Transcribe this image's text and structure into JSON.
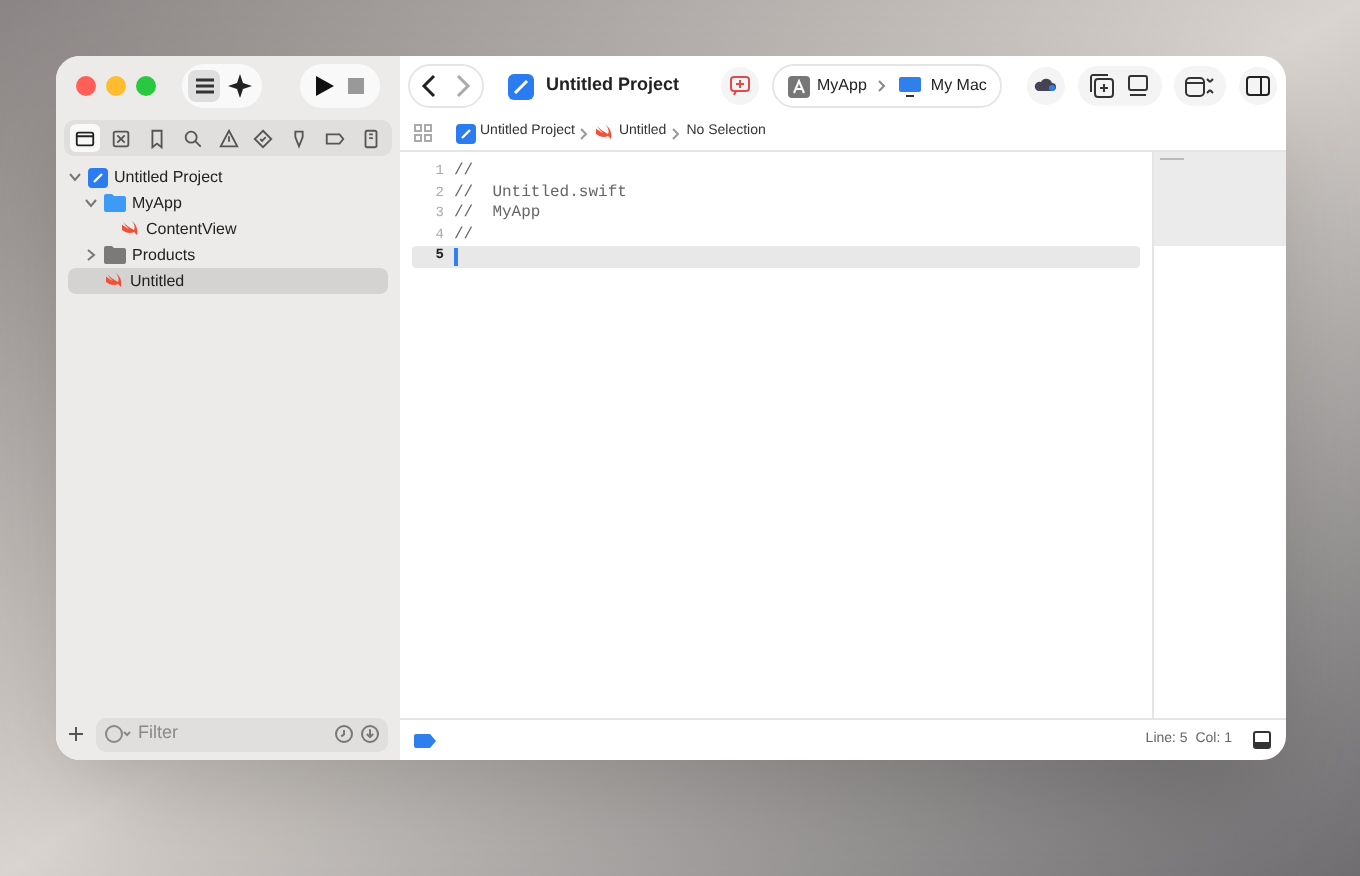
{
  "toolbar": {
    "project_title": "Untitled Project",
    "scheme": "MyApp",
    "destination": "My Mac"
  },
  "navigator_tabs": [
    {
      "selected": true
    },
    {
      "selected": false
    },
    {
      "selected": false
    },
    {
      "selected": false
    },
    {
      "selected": false
    },
    {
      "selected": false
    },
    {
      "selected": false
    },
    {
      "selected": false
    },
    {
      "selected": false
    }
  ],
  "tree": [
    {
      "label": "Untitled Project",
      "kind": "project",
      "expanded": true,
      "selected": false,
      "children": [
        {
          "label": "MyApp",
          "kind": "folder",
          "expanded": true,
          "selected": false,
          "children": [
            {
              "label": "ContentView",
              "kind": "swift",
              "selected": false
            }
          ]
        },
        {
          "label": "Products",
          "kind": "group",
          "expanded": false,
          "selected": false
        },
        {
          "label": "Untitled",
          "kind": "swift",
          "selected": true
        }
      ]
    }
  ],
  "filter": {
    "placeholder": "Filter"
  },
  "breadcrumb": [
    {
      "label": "Untitled Project",
      "kind": "project"
    },
    {
      "label": "Untitled",
      "kind": "swift"
    },
    {
      "label": "No Selection",
      "kind": "text"
    }
  ],
  "code_lines": [
    {
      "number": "1",
      "text": "//",
      "current": false
    },
    {
      "number": "2",
      "text": "//  Untitled.swift",
      "current": false
    },
    {
      "number": "3",
      "text": "//  MyApp",
      "current": false
    },
    {
      "number": "4",
      "text": "//",
      "current": false
    },
    {
      "number": "5",
      "current": true
    }
  ],
  "status": {
    "position": "Line: 5  Col: 1"
  }
}
